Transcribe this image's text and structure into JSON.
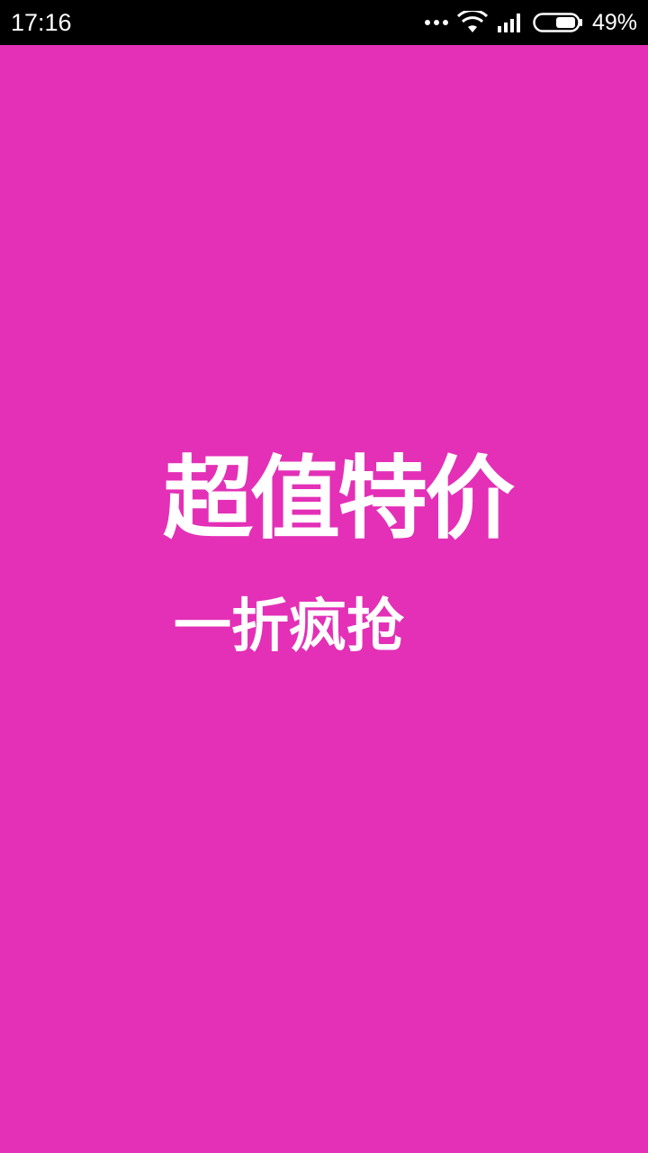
{
  "status_bar": {
    "time": "17:16",
    "battery_percent": "49%",
    "icons": [
      "more-dots-icon",
      "wifi-icon",
      "signal-icon",
      "battery-icon"
    ]
  },
  "splash": {
    "background_color": "#e330b7",
    "headline": "超值特价",
    "subheadline": "一折疯抢"
  }
}
